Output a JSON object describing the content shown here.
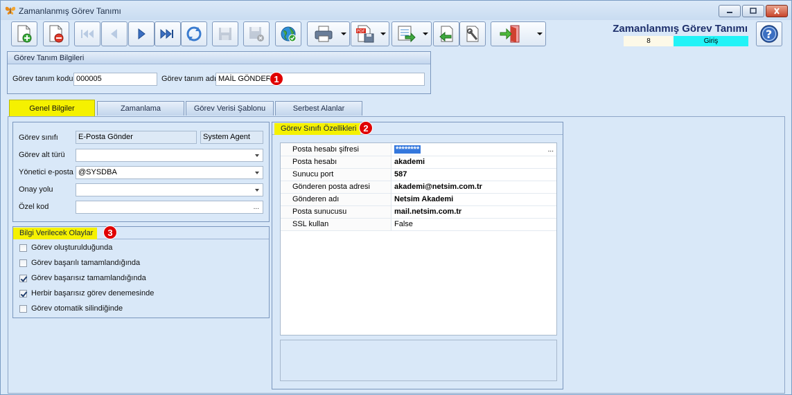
{
  "window": {
    "title": "Zamanlanmış Görev Tanımı"
  },
  "header": {
    "form_title": "Zamanlanmış Görev Tanımı",
    "record_no": "8",
    "mode": "Giriş"
  },
  "toolbar": {
    "buttons": [
      {
        "name": "new-record-button",
        "icon": "new-document-icon"
      },
      {
        "name": "delete-record-button",
        "icon": "delete-document-icon"
      },
      {
        "name": "first-record-button",
        "icon": "first-icon"
      },
      {
        "name": "previous-record-button",
        "icon": "previous-icon"
      },
      {
        "name": "next-record-button",
        "icon": "next-icon"
      },
      {
        "name": "last-record-button",
        "icon": "last-icon"
      },
      {
        "name": "refresh-button",
        "icon": "refresh-icon"
      },
      {
        "name": "save-button",
        "icon": "save-icon"
      },
      {
        "name": "save-close-button",
        "icon": "save-close-icon"
      },
      {
        "name": "web-button",
        "icon": "globe-icon"
      },
      {
        "name": "print-button",
        "icon": "printer-icon"
      },
      {
        "name": "export-pdf-button",
        "icon": "pdf-icon"
      },
      {
        "name": "export-button",
        "icon": "export-icon"
      },
      {
        "name": "back-button",
        "icon": "back-icon"
      },
      {
        "name": "tools-button",
        "icon": "tools-icon"
      },
      {
        "name": "exit-button",
        "icon": "exit-icon"
      },
      {
        "name": "help-button",
        "icon": "help-icon"
      }
    ]
  },
  "definition": {
    "panel_title": "Görev Tanım Bilgileri",
    "code_label": "Görev tanım kodu",
    "code_value": "000005",
    "name_label": "Görev tanım adı",
    "name_value": "MAİL GÖNDER",
    "marker": "1"
  },
  "tabs": [
    "Genel Bilgiler",
    "Zamanlama",
    "Görev Verisi Şablonu",
    "Serbest Alanlar"
  ],
  "general": {
    "class_label": "Görev sınıfı",
    "class_value": "E-Posta Gönder",
    "agent_value": "System Agent",
    "subtype_label": "Görev alt türü",
    "subtype_value": "",
    "manager_label": "Yönetici e-posta",
    "manager_value": "@SYSDBA",
    "approval_label": "Onay yolu",
    "approval_value": "",
    "special_label": "Özel kod",
    "special_value": ""
  },
  "events": {
    "panel_title": "Bilgi Verilecek Olaylar",
    "marker": "3",
    "items": [
      {
        "label": "Görev oluşturulduğunda",
        "checked": false
      },
      {
        "label": "Görev başarılı tamamlandığında",
        "checked": false
      },
      {
        "label": "Görev başarısız tamamlandığında",
        "checked": true
      },
      {
        "label": "Herbir başarısız görev denemesinde",
        "checked": true
      },
      {
        "label": "Görev otomatik silindiğinde",
        "checked": false
      }
    ]
  },
  "properties": {
    "panel_title": "Görev Sınıfı Özellikleri",
    "marker": "2",
    "rows": [
      {
        "label": "Posta hesabı şifresi",
        "value": "********",
        "bold": true
      },
      {
        "label": "Posta hesabı",
        "value": "akademi",
        "bold": true
      },
      {
        "label": "Sunucu port",
        "value": "587",
        "bold": true
      },
      {
        "label": "Gönderen posta adresi",
        "value": "akademi@netsim.com.tr",
        "bold": true
      },
      {
        "label": "Gönderen adı",
        "value": "Netsim Akademi",
        "bold": true
      },
      {
        "label": "Posta sunucusu",
        "value": "mail.netsim.com.tr",
        "bold": true
      },
      {
        "label": "SSL kullan",
        "value": "False",
        "bold": false
      }
    ],
    "ellipsis": "..."
  }
}
